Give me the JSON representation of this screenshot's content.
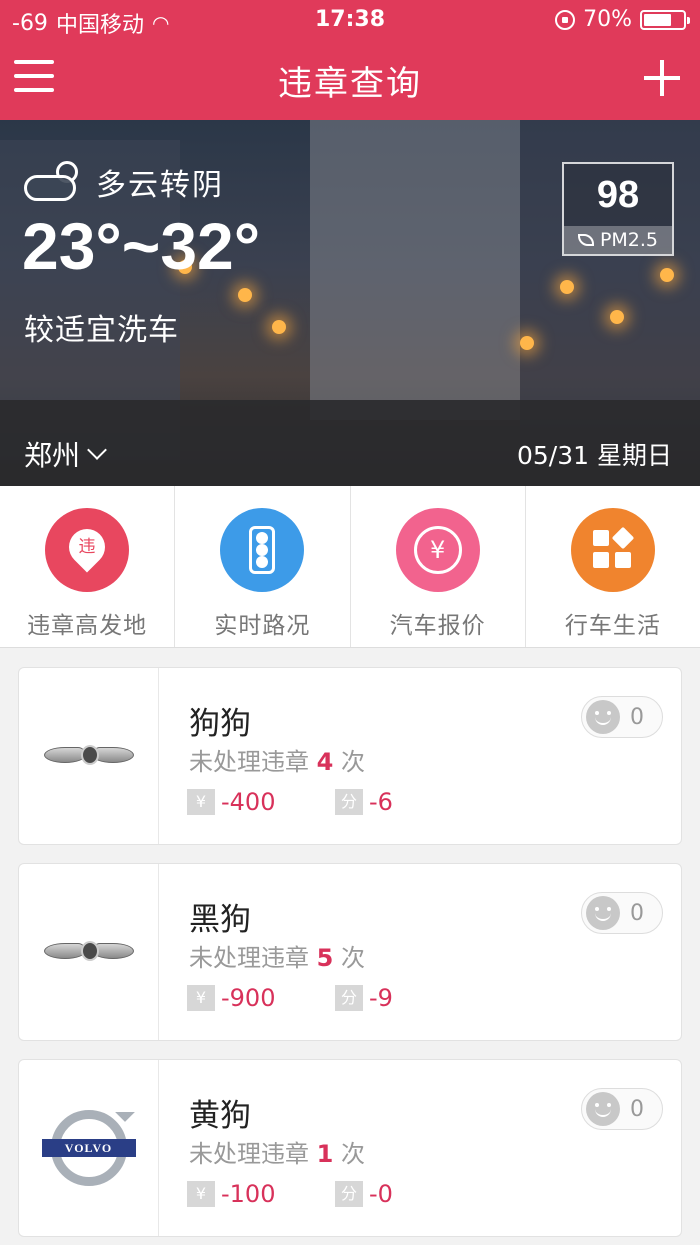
{
  "status_bar": {
    "signal": "-69",
    "carrier": "中国移动",
    "time": "17:38",
    "battery": "70%",
    "battery_level": 0.7
  },
  "nav": {
    "title": "违章查询"
  },
  "weather": {
    "condition": "多云转阴",
    "temperature": "23°~32°",
    "car_wash": "较适宜洗车",
    "pm_value": "98",
    "pm_label": "PM2.5",
    "city": "郑州",
    "date": "05/31  星期日"
  },
  "quick_nav": [
    {
      "label": "违章高发地",
      "icon": "violation-pin-icon",
      "icon_text": "违",
      "color": "#e8475f"
    },
    {
      "label": "实时路况",
      "icon": "traffic-light-icon",
      "color": "#3d9be8"
    },
    {
      "label": "汽车报价",
      "icon": "yen-refresh-icon",
      "icon_text": "¥",
      "color": "#f2638e"
    },
    {
      "label": "行车生活",
      "icon": "apps-grid-icon",
      "color": "#f0842e"
    }
  ],
  "cars": [
    {
      "name": "狗狗",
      "violation_prefix": "未处理违章",
      "count": "4",
      "violation_suffix": "次",
      "fine_tag": "¥",
      "fine": "-400",
      "points_tag": "分",
      "points": "-6",
      "likes": "0",
      "brand_logo": "winged-badge-logo"
    },
    {
      "name": "黑狗",
      "violation_prefix": "未处理违章",
      "count": "5",
      "violation_suffix": "次",
      "fine_tag": "¥",
      "fine": "-900",
      "points_tag": "分",
      "points": "-9",
      "likes": "0",
      "brand_logo": "winged-badge-logo"
    },
    {
      "name": "黄狗",
      "violation_prefix": "未处理违章",
      "count": "1",
      "violation_suffix": "次",
      "fine_tag": "¥",
      "fine": "-100",
      "points_tag": "分",
      "points": "-0",
      "likes": "0",
      "brand_logo": "volvo-logo",
      "brand_text": "VOLVO"
    }
  ]
}
